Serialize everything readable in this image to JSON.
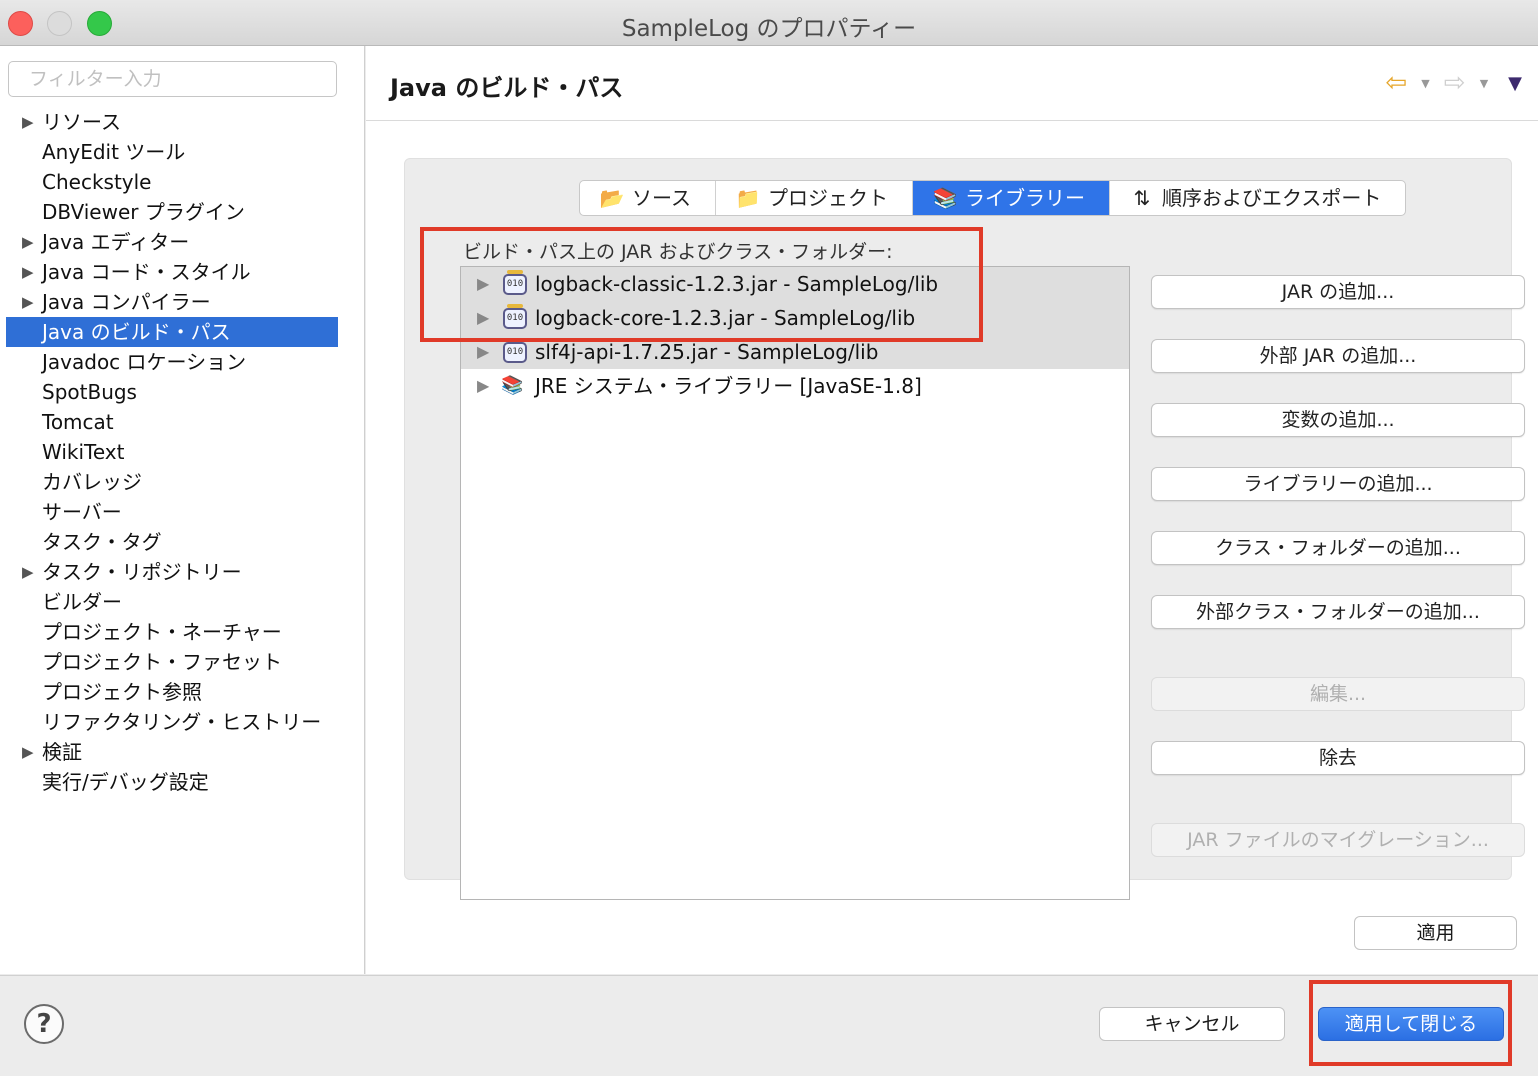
{
  "window": {
    "title": "SampleLog のプロパティー"
  },
  "sidebar": {
    "filter_placeholder": "フィルター入力",
    "items": [
      {
        "label": "リソース",
        "expandable": true
      },
      {
        "label": "AnyEdit ツール",
        "expandable": false
      },
      {
        "label": "Checkstyle",
        "expandable": false
      },
      {
        "label": "DBViewer プラグイン",
        "expandable": false
      },
      {
        "label": "Java エディター",
        "expandable": true
      },
      {
        "label": "Java コード・スタイル",
        "expandable": true
      },
      {
        "label": "Java コンパイラー",
        "expandable": true
      },
      {
        "label": "Java のビルド・パス",
        "expandable": false,
        "selected": true
      },
      {
        "label": "Javadoc ロケーション",
        "expandable": false
      },
      {
        "label": "SpotBugs",
        "expandable": false
      },
      {
        "label": "Tomcat",
        "expandable": false
      },
      {
        "label": "WikiText",
        "expandable": false
      },
      {
        "label": "カバレッジ",
        "expandable": false
      },
      {
        "label": "サーバー",
        "expandable": false
      },
      {
        "label": "タスク・タグ",
        "expandable": false
      },
      {
        "label": "タスク・リポジトリー",
        "expandable": true
      },
      {
        "label": "ビルダー",
        "expandable": false
      },
      {
        "label": "プロジェクト・ネーチャー",
        "expandable": false
      },
      {
        "label": "プロジェクト・ファセット",
        "expandable": false
      },
      {
        "label": "プロジェクト参照",
        "expandable": false
      },
      {
        "label": "リファクタリング・ヒストリー",
        "expandable": false
      },
      {
        "label": "検証",
        "expandable": true
      },
      {
        "label": "実行/デバッグ設定",
        "expandable": false
      }
    ]
  },
  "page": {
    "title": "Java のビルド・パス"
  },
  "tabs": [
    {
      "label": "ソース",
      "icon": "source-folder-icon"
    },
    {
      "label": "プロジェクト",
      "icon": "project-folder-icon"
    },
    {
      "label": "ライブラリー",
      "icon": "library-icon",
      "active": true
    },
    {
      "label": "順序およびエクスポート",
      "icon": "order-export-icon"
    }
  ],
  "list": {
    "label": "ビルド・パス上の JAR およびクラス・フォルダー:",
    "rows": [
      {
        "label": "logback-classic-1.2.3.jar - SampleLog/lib",
        "icon": "jar-icon",
        "selected": true
      },
      {
        "label": "logback-core-1.2.3.jar - SampleLog/lib",
        "icon": "jar-icon",
        "selected": true
      },
      {
        "label": "slf4j-api-1.7.25.jar - SampleLog/lib",
        "icon": "jar-icon",
        "selected": true
      },
      {
        "label": "JRE システム・ライブラリー [JavaSE-1.8]",
        "icon": "jre-library-icon",
        "selected": false
      }
    ]
  },
  "buttons": {
    "add_jar": "JAR の追加...",
    "add_external_jar": "外部 JAR の追加...",
    "add_variable": "変数の追加...",
    "add_library": "ライブラリーの追加...",
    "add_class_folder": "クラス・フォルダーの追加...",
    "add_external_class_folder": "外部クラス・フォルダーの追加...",
    "edit": "編集...",
    "remove": "除去",
    "migrate_jar": "JAR ファイルのマイグレーション..."
  },
  "apply_label": "適用",
  "footer": {
    "help": "?",
    "cancel": "キャンセル",
    "apply_and_close": "適用して閉じる"
  },
  "colors": {
    "selection": "#2f6fd6",
    "highlight": "#e03a28",
    "primary_button": "#2b6fe3"
  }
}
